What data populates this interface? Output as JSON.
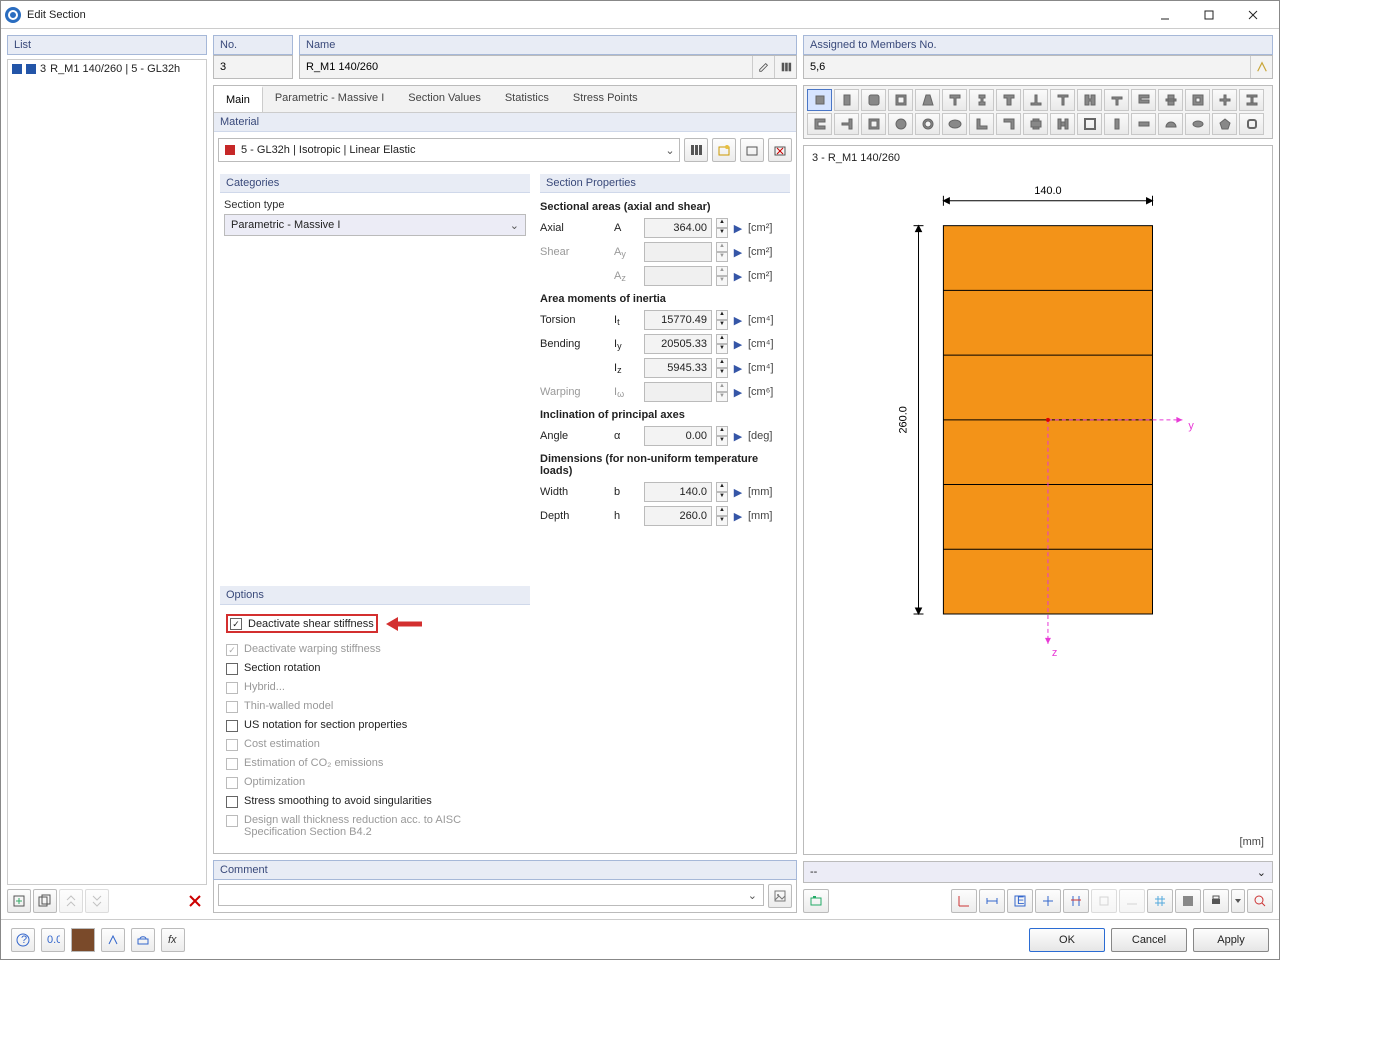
{
  "window": {
    "title": "Edit Section"
  },
  "list": {
    "header": "List",
    "item": {
      "num": "3",
      "label": "R_M1 140/260 | 5 - GL32h"
    }
  },
  "fields": {
    "no_label": "No.",
    "no_value": "3",
    "name_label": "Name",
    "name_value": "R_M1 140/260",
    "assigned_label": "Assigned to Members No.",
    "assigned_value": "5,6"
  },
  "tabs": [
    "Main",
    "Parametric - Massive I",
    "Section Values",
    "Statistics",
    "Stress Points"
  ],
  "material": {
    "header": "Material",
    "value": "5 - GL32h | Isotropic | Linear Elastic"
  },
  "categories": {
    "header": "Categories",
    "type_label": "Section type",
    "type_value": "Parametric - Massive I"
  },
  "options": {
    "header": "Options",
    "items": [
      {
        "label": "Deactivate shear stiffness",
        "checked": true,
        "enabled": true,
        "highlight": true
      },
      {
        "label": "Deactivate warping stiffness",
        "checked": true,
        "enabled": false
      },
      {
        "label": "Section rotation",
        "checked": false,
        "enabled": true
      },
      {
        "label": "Hybrid...",
        "checked": false,
        "enabled": false
      },
      {
        "label": "Thin-walled model",
        "checked": false,
        "enabled": false
      },
      {
        "label": "US notation for section properties",
        "checked": false,
        "enabled": true
      },
      {
        "label": "Cost estimation",
        "checked": false,
        "enabled": false
      },
      {
        "label": "Estimation of CO₂ emissions",
        "checked": false,
        "enabled": false
      },
      {
        "label": "Optimization",
        "checked": false,
        "enabled": false
      },
      {
        "label": "Stress smoothing to avoid singularities",
        "checked": false,
        "enabled": true
      },
      {
        "label": "Design wall thickness reduction acc. to AISC Specification Section B4.2",
        "checked": false,
        "enabled": false
      }
    ]
  },
  "props": {
    "header": "Section Properties",
    "areas_head": "Sectional areas (axial and shear)",
    "rows_areas": [
      {
        "label": "Axial",
        "sym": "A",
        "val": "364.00",
        "unit": "[cm²]",
        "enabled": true
      },
      {
        "label": "Shear",
        "sym": "A",
        "sub": "y",
        "val": "",
        "unit": "[cm²]",
        "enabled": false
      },
      {
        "label": "",
        "sym": "A",
        "sub": "z",
        "val": "",
        "unit": "[cm²]",
        "enabled": false
      }
    ],
    "inertia_head": "Area moments of inertia",
    "rows_inertia": [
      {
        "label": "Torsion",
        "sym": "I",
        "sub": "t",
        "val": "15770.49",
        "unit": "[cm⁴]",
        "enabled": true
      },
      {
        "label": "Bending",
        "sym": "I",
        "sub": "y",
        "val": "20505.33",
        "unit": "[cm⁴]",
        "enabled": true
      },
      {
        "label": "",
        "sym": "I",
        "sub": "z",
        "val": "5945.33",
        "unit": "[cm⁴]",
        "enabled": true
      },
      {
        "label": "Warping",
        "sym": "I",
        "sub": "ω",
        "val": "",
        "unit": "[cm⁶]",
        "enabled": false
      }
    ],
    "incl_head": "Inclination of principal axes",
    "rows_incl": [
      {
        "label": "Angle",
        "sym": "α",
        "val": "0.00",
        "unit": "[deg]",
        "enabled": true
      }
    ],
    "dim_head": "Dimensions (for non-uniform temperature loads)",
    "rows_dim": [
      {
        "label": "Width",
        "sym": "b",
        "val": "140.0",
        "unit": "[mm]",
        "enabled": true
      },
      {
        "label": "Depth",
        "sym": "h",
        "val": "260.0",
        "unit": "[mm]",
        "enabled": true
      }
    ]
  },
  "preview": {
    "title": "3 - R_M1 140/260",
    "width_label": "140.0",
    "height_label": "260.0",
    "unit": "[mm]",
    "dropdown": "--"
  },
  "comment": {
    "header": "Comment",
    "value": ""
  },
  "buttons": {
    "ok": "OK",
    "cancel": "Cancel",
    "apply": "Apply"
  }
}
